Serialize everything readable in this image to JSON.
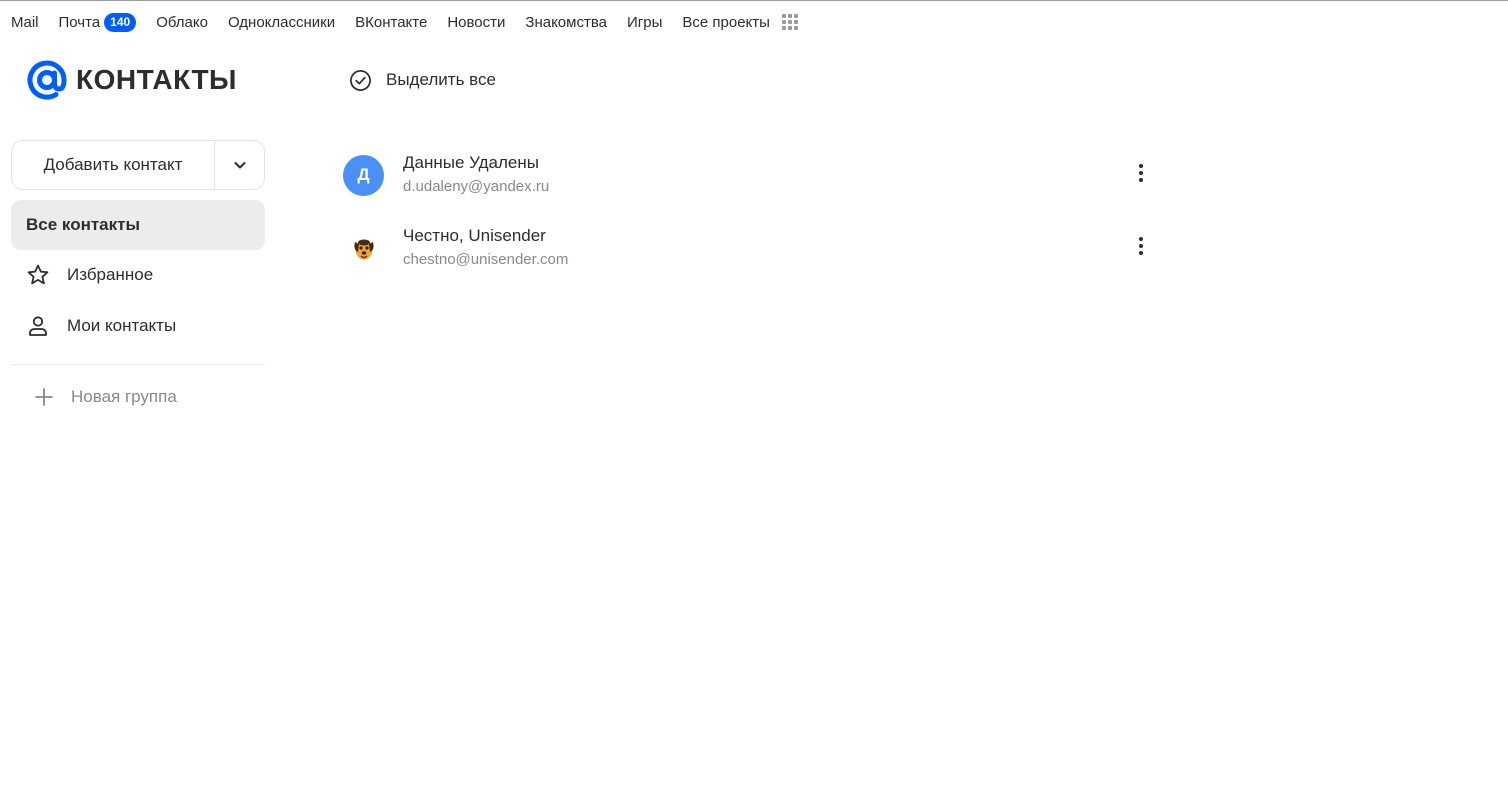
{
  "topbar": {
    "items": [
      {
        "label": "Mail"
      },
      {
        "label": "Почта",
        "badge": "140"
      },
      {
        "label": "Облако"
      },
      {
        "label": "Одноклассники"
      },
      {
        "label": "ВКонтакте"
      },
      {
        "label": "Новости"
      },
      {
        "label": "Знакомства"
      },
      {
        "label": "Игры"
      },
      {
        "label": "Все проекты"
      }
    ]
  },
  "logo": {
    "text": "КОНТАКТЫ",
    "color": "#005ff9"
  },
  "sidebar": {
    "add_contact_label": "Добавить контакт",
    "items": [
      {
        "label": "Все контакты",
        "active": true
      },
      {
        "label": "Избранное",
        "icon": "star-icon"
      },
      {
        "label": "Мои контакты",
        "icon": "person-icon"
      }
    ],
    "new_group_label": "Новая группа"
  },
  "main": {
    "select_all_label": "Выделить все",
    "contacts": [
      {
        "initial": "Д",
        "name": "Данные Удалены",
        "email": "d.udaleny@yandex.ru",
        "avatar_color": "#4a90f5"
      },
      {
        "initial": "",
        "name": "Честно, Unisender",
        "email": "chestno@unisender.com",
        "avatar_icon": "dog-avatar-icon"
      }
    ]
  }
}
